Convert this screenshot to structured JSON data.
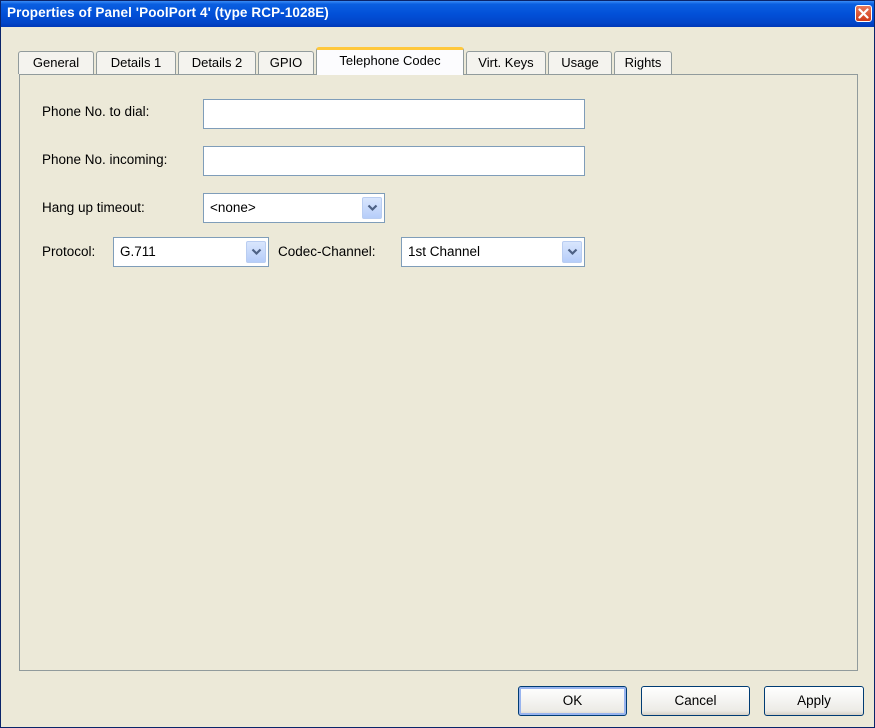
{
  "window": {
    "title": "Properties of Panel 'PoolPort 4' (type RCP-1028E)"
  },
  "tabs": [
    {
      "label": "General"
    },
    {
      "label": "Details 1"
    },
    {
      "label": "Details 2"
    },
    {
      "label": "GPIO"
    },
    {
      "label": "Telephone Codec",
      "active": true
    },
    {
      "label": "Virt. Keys"
    },
    {
      "label": "Usage"
    },
    {
      "label": "Rights"
    }
  ],
  "form": {
    "phone_dial": {
      "label": "Phone No. to dial:",
      "value": ""
    },
    "phone_incoming": {
      "label": "Phone No. incoming:",
      "value": ""
    },
    "hangup": {
      "label": "Hang up timeout:",
      "value": "<none>"
    },
    "protocol": {
      "label": "Protocol:",
      "value": "G.711"
    },
    "codec_channel": {
      "label": "Codec-Channel:",
      "value": "1st Channel"
    }
  },
  "buttons": {
    "ok": "OK",
    "cancel": "Cancel",
    "apply": "Apply"
  },
  "colors": {
    "titlebar": "#0250d8",
    "active_tab_accent": "#ffc83c",
    "panel_bg": "#ece9d8"
  }
}
